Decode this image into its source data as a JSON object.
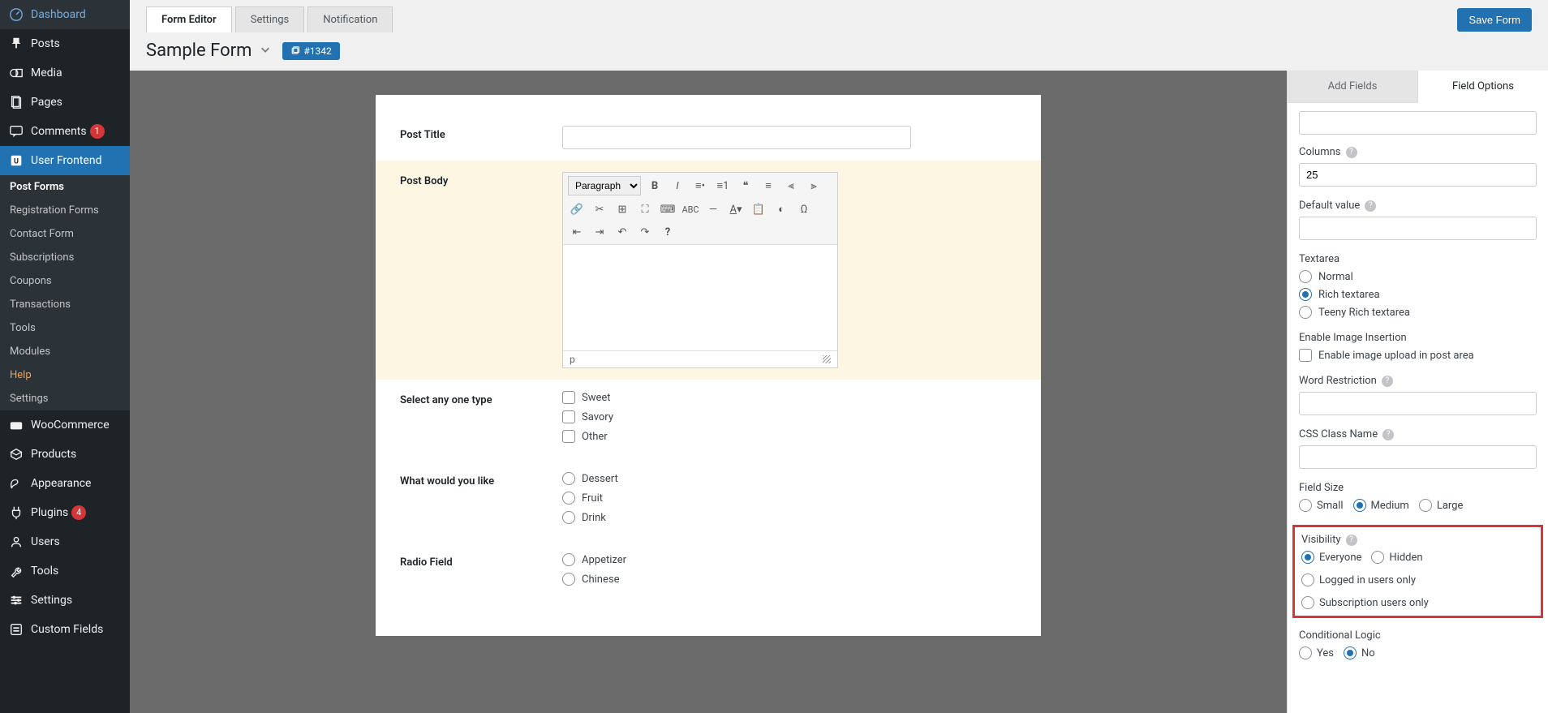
{
  "sidebar": {
    "items": [
      {
        "icon": "dashboard",
        "label": "Dashboard"
      },
      {
        "icon": "pin",
        "label": "Posts"
      },
      {
        "icon": "media",
        "label": "Media"
      },
      {
        "icon": "page",
        "label": "Pages"
      },
      {
        "icon": "comment",
        "label": "Comments",
        "badge": "1"
      },
      {
        "icon": "wpuf",
        "label": "User Frontend",
        "active": true
      },
      {
        "icon": "woo",
        "label": "WooCommerce"
      },
      {
        "icon": "product",
        "label": "Products"
      },
      {
        "icon": "appearance",
        "label": "Appearance"
      },
      {
        "icon": "plugin",
        "label": "Plugins",
        "badge": "4"
      },
      {
        "icon": "users",
        "label": "Users"
      },
      {
        "icon": "tools",
        "label": "Tools"
      },
      {
        "icon": "settings",
        "label": "Settings"
      },
      {
        "icon": "custom",
        "label": "Custom Fields"
      }
    ],
    "sub": [
      {
        "label": "Post Forms",
        "current": true
      },
      {
        "label": "Registration Forms"
      },
      {
        "label": "Contact Form"
      },
      {
        "label": "Subscriptions"
      },
      {
        "label": "Coupons"
      },
      {
        "label": "Transactions"
      },
      {
        "label": "Tools"
      },
      {
        "label": "Modules"
      },
      {
        "label": "Help",
        "highlight": true
      },
      {
        "label": "Settings"
      }
    ]
  },
  "topbar": {
    "tabs": [
      {
        "label": "Form Editor",
        "active": true
      },
      {
        "label": "Settings"
      },
      {
        "label": "Notification"
      }
    ],
    "save_label": "Save Form"
  },
  "titlebar": {
    "title": "Sample Form",
    "id_prefix": "#",
    "id": "1342"
  },
  "form_fields": [
    {
      "label": "Post Title",
      "type": "text"
    },
    {
      "label": "Post Body",
      "type": "richtext",
      "selected": true,
      "format_select": "Paragraph",
      "status_path": "p"
    },
    {
      "label": "Select any one type",
      "type": "checkboxes",
      "options": [
        "Sweet",
        "Savory",
        "Other"
      ]
    },
    {
      "label": "What would you like",
      "type": "radios",
      "options": [
        "Dessert",
        "Fruit",
        "Drink"
      ]
    },
    {
      "label": "Radio Field",
      "type": "radios",
      "options": [
        "Appetizer",
        "Chinese"
      ]
    }
  ],
  "right_panel": {
    "tabs": [
      {
        "label": "Add Fields"
      },
      {
        "label": "Field Options",
        "active": true
      }
    ],
    "columns": {
      "label": "Columns",
      "value": "25"
    },
    "default_value": {
      "label": "Default value",
      "value": ""
    },
    "textarea": {
      "label": "Textarea",
      "options": [
        "Normal",
        "Rich textarea",
        "Teeny Rich textarea"
      ],
      "selected": "Rich textarea"
    },
    "enable_image": {
      "label": "Enable Image Insertion",
      "checkbox_label": "Enable image upload in post area",
      "checked": false
    },
    "word_restriction": {
      "label": "Word Restriction",
      "value": ""
    },
    "css_class": {
      "label": "CSS Class Name",
      "value": ""
    },
    "field_size": {
      "label": "Field Size",
      "options": [
        "Small",
        "Medium",
        "Large"
      ],
      "selected": "Medium"
    },
    "visibility": {
      "label": "Visibility",
      "options": [
        "Everyone",
        "Hidden",
        "Logged in users only",
        "Subscription users only"
      ],
      "selected": "Everyone"
    },
    "conditional": {
      "label": "Conditional Logic",
      "options": [
        "Yes",
        "No"
      ],
      "selected": "No"
    }
  }
}
